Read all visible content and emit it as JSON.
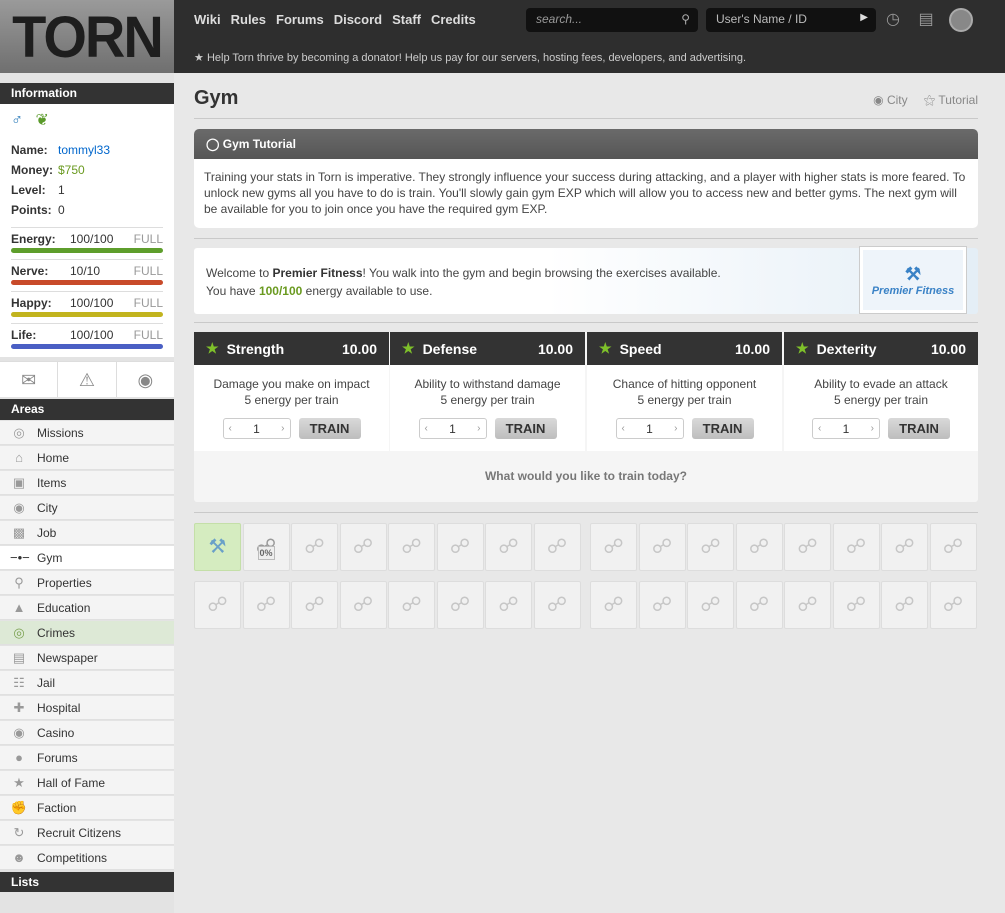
{
  "header": {
    "logo": "TORN",
    "nav": [
      "Wiki",
      "Rules",
      "Forums",
      "Discord",
      "Staff",
      "Credits"
    ],
    "search_placeholder": "search...",
    "user_placeholder": "User's Name / ID",
    "donate": "Help Torn thrive by becoming a donator! Help us pay for our servers, hosting fees, developers, and advertising."
  },
  "sidebar": {
    "info_title": "Information",
    "name_label": "Name:",
    "name": "tommyl33",
    "money_label": "Money:",
    "money": "$750",
    "level_label": "Level:",
    "level": "1",
    "points_label": "Points:",
    "points": "0",
    "bars": [
      {
        "label": "Energy:",
        "value": "100/100",
        "status": "FULL",
        "color": "#5e9e2c",
        "fill": 1.0
      },
      {
        "label": "Nerve:",
        "value": "10/10",
        "status": "FULL",
        "color": "#c84a2a",
        "fill": 1.0
      },
      {
        "label": "Happy:",
        "value": "100/100",
        "status": "FULL",
        "color": "#c2b41e",
        "fill": 1.0
      },
      {
        "label": "Life:",
        "value": "100/100",
        "status": "FULL",
        "color": "#4a5fc4",
        "fill": 1.0
      }
    ],
    "areas_title": "Areas",
    "areas": [
      "Missions",
      "Home",
      "Items",
      "City",
      "Job",
      "Gym",
      "Properties",
      "Education",
      "Crimes",
      "Newspaper",
      "Jail",
      "Hospital",
      "Casino",
      "Forums",
      "Hall of Fame",
      "Faction",
      "Recruit Citizens",
      "Competitions"
    ],
    "lists_title": "Lists"
  },
  "main": {
    "title": "Gym",
    "city_link": "City",
    "tutorial_link": "Tutorial",
    "tutorial_title": "Gym Tutorial",
    "tutorial_text": "Training your stats in Torn is imperative. They strongly influence your success during attacking, and a player with higher stats is more feared. To unlock new gyms all you have to do is train. You'll slowly gain gym EXP which will allow you to access new and better gyms. The next gym will be available for you to join once you have the required gym EXP.",
    "welcome_pre": "Welcome to ",
    "gym_name": "Premier Fitness",
    "welcome_post": "! You walk into the gym and begin browsing the exercises available.",
    "energy_pre": "You have ",
    "energy": "100/100",
    "energy_post": " energy available to use.",
    "gym_logo_text": "Premier Fitness",
    "stats": [
      {
        "name": "Strength",
        "value": "10.00",
        "desc": "Damage you make on impact",
        "cost": "5 energy per train",
        "qty": "1",
        "button": "TRAIN"
      },
      {
        "name": "Defense",
        "value": "10.00",
        "desc": "Ability to withstand damage",
        "cost": "5 energy per train",
        "qty": "1",
        "button": "TRAIN"
      },
      {
        "name": "Speed",
        "value": "10.00",
        "desc": "Chance of hitting opponent",
        "cost": "5 energy per train",
        "qty": "1",
        "button": "TRAIN"
      },
      {
        "name": "Dexterity",
        "value": "10.00",
        "desc": "Ability to evade an attack",
        "cost": "5 energy per train",
        "qty": "1",
        "button": "TRAIN"
      }
    ],
    "prompt": "What would you like to train today?",
    "progress": "0%"
  }
}
